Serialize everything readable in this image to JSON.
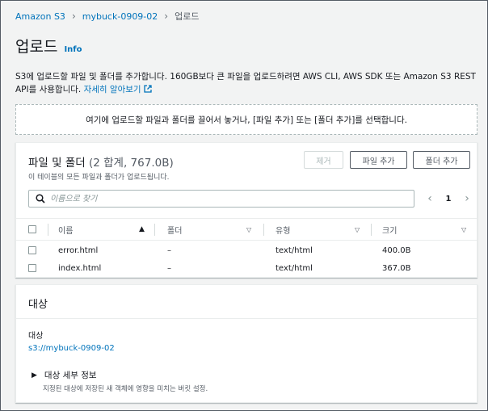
{
  "breadcrumb": {
    "items": [
      "Amazon S3",
      "mybuck-0909-02",
      "업로드"
    ]
  },
  "page": {
    "title": "업로드",
    "info_label": "Info",
    "description": "S3에 업로드할 파일 및 폴더를 추가합니다. 160GB보다 큰 파일을 업로드하려면 AWS CLI, AWS SDK 또는 Amazon S3 REST API를 사용합니다.",
    "learn_more": "자세히 알아보기"
  },
  "dropzone": {
    "text": "여기에 업로드할 파일과 폴더를 끌어서 놓거나, [파일 추가] 또는 [폴더 추가]를 선택합니다."
  },
  "files_panel": {
    "title": "파일 및 폴더",
    "count": "(2 합계, 767.0B)",
    "subtitle": "이 테이블의 모든 파일과 폴더가 업로드됩니다.",
    "remove_label": "제거",
    "add_files_label": "파일 추가",
    "add_folder_label": "폴더 추가",
    "search_placeholder": "이름으로 찾기",
    "page_number": "1",
    "columns": [
      "이름",
      "폴더",
      "유형",
      "크기"
    ],
    "rows": [
      {
        "name": "error.html",
        "folder": "–",
        "type": "text/html",
        "size": "400.0B"
      },
      {
        "name": "index.html",
        "folder": "–",
        "type": "text/html",
        "size": "367.0B"
      }
    ]
  },
  "destination": {
    "header": "대상",
    "label": "대상",
    "path": "s3://mybuck-0909-02",
    "details_label": "대상 세부 정보",
    "details_sub": "지정된 대상에 저장된 새 객체에 영향을 미치는 버킷 설정."
  },
  "colors": {
    "link": "#0073bb",
    "text": "#16191f",
    "muted": "#545b64",
    "background": "#f2f3f3"
  }
}
